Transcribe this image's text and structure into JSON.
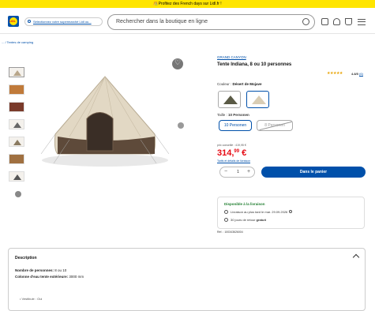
{
  "promo": {
    "text": "🎊Profitez des French days sur Lidl.fr !"
  },
  "header": {
    "logo_text": "LIDL",
    "store_link": "Sélectionnez votre supermarché Lidl ou...",
    "search_placeholder": "Rechercher dans la boutique en ligne"
  },
  "breadcrumb": {
    "text": "... / Tentes de camping"
  },
  "product": {
    "brand": "GRAND CANYON",
    "title": "Tente Indiana, 8 ou 10 personnes",
    "stars": "★★★★★",
    "rating_value": "4.8/5",
    "rating_count": "(6)",
    "color_label": "Couleur :",
    "color_value": "Désert de Mojave",
    "size_label": "Taille :",
    "size_value": "10 Personen",
    "sizes": [
      "10 Personen",
      "8 Personen"
    ],
    "old_price": "prix conseillé : 419,95 €",
    "price_main": "314,",
    "price_cents": "99",
    "price_currency": " €",
    "tarifs_link": "Tarifs et détails de livraison",
    "qty_minus": "−",
    "qty_value": "1",
    "qty_plus": "+",
    "cart_button": "Dans le panier",
    "availability_title": "Disponible à la livraison",
    "delivery_text": "Livraison au plus tard le mar. 29.09.2026",
    "return_text": "30 jours de retour ",
    "return_bold": "gratuit",
    "ref": "Réf. : 100343626004"
  },
  "description": {
    "heading": "Description",
    "people_label": "Nombre de personnes:",
    "people_value": " 8 ou 10",
    "column_label": "Colonne d'eau tente extérieure:",
    "column_value": " 3000 mm",
    "more": "• Vestibule : Oui"
  },
  "colors": {
    "accent": "#0050aa",
    "price": "#e60a14",
    "promo": "#ffe500",
    "available": "#1e7d2e"
  }
}
